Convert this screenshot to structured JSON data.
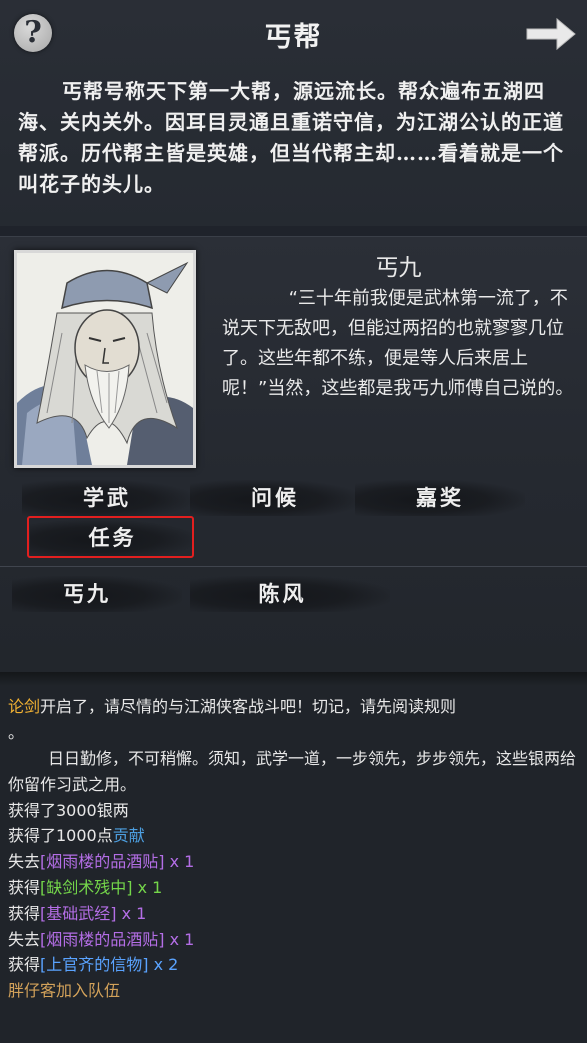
{
  "header": {
    "title": "丐帮",
    "help_glyph": "?",
    "next_icon": "arrow-right-icon"
  },
  "intro": "丐帮号称天下第一大帮，源远流长。帮众遍布五湖四海、关内关外。因耳目灵通且重诺守信，为江湖公认的正道帮派。历代帮主皆是英雄，但当代帮主却……看着就是一个叫花子的头儿。",
  "npc": {
    "name": "丐九",
    "description": "“三十年前我便是武林第一流了，不说天下无敌吧，但能过两招的也就寥寥几位了。这些年都不练，便是等人后来居上呢！”当然，这些都是我丐九师傅自己说的。"
  },
  "actions": [
    "学武",
    "问候",
    "嘉奖",
    "任务"
  ],
  "members": [
    "丐九",
    "陈风"
  ],
  "log": {
    "line1": {
      "a": "论剑",
      "b": "开启了，请尽情的与江湖侠客战斗吧！切记，请先阅读规则"
    },
    "line1_tail": "。",
    "para": "日日勤修，不可稍懈。须知，武学一道，一步领先，步步领先，这些银两给你留作习武之用。",
    "silver": "获得了3000银两",
    "contrib_prefix": "获得了1000点",
    "contrib_word": "贡献",
    "items": [
      {
        "verb": "失去",
        "item": "[烟雨楼的品酒贴]",
        "count": " x 1",
        "color": "#b46ee6"
      },
      {
        "verb": "获得",
        "item": "[缺剑术残中]",
        "count": " x 1",
        "color": "#74d64a"
      },
      {
        "verb": "获得",
        "item": "[基础武经]",
        "count": " x 1",
        "color": "#b46ee6"
      },
      {
        "verb": "失去",
        "item": "[烟雨楼的品酒贴]",
        "count": " x 1",
        "color": "#b46ee6"
      },
      {
        "verb": "获得",
        "item": "[上官齐的信物]",
        "count": " x 2",
        "color": "#5aa3ff"
      }
    ],
    "last": "胖仔客加入队伍"
  }
}
